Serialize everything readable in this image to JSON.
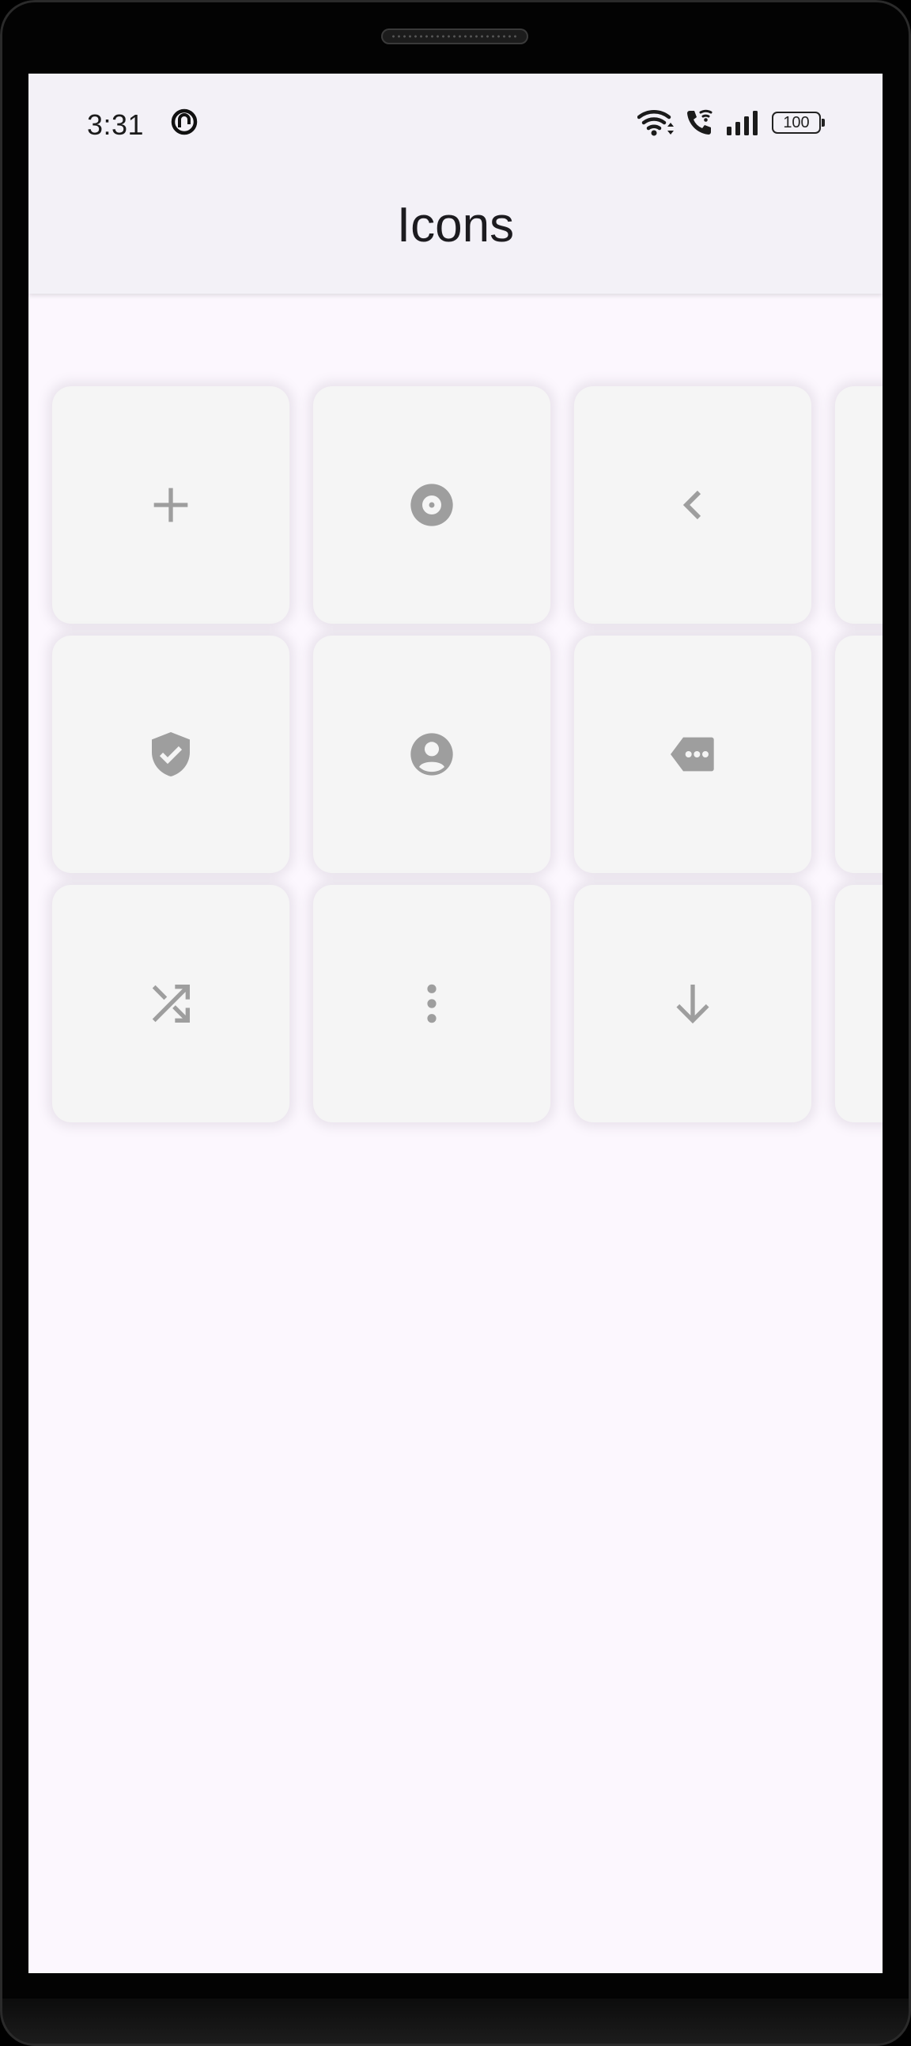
{
  "status_bar": {
    "time": "3:31",
    "app_icon": "notification-app-icon",
    "wifi_icon": "wifi-icon",
    "call_icon": "wifi-call-icon",
    "signal_icon": "signal-icon",
    "battery_level": "100"
  },
  "app_bar": {
    "title": "Icons"
  },
  "colors": {
    "app_bar_bg": "#f3f1f7",
    "screen_bg": "#fcf7fe",
    "tile_bg": "#f5f5f5",
    "icon_color": "#9e9e9e"
  },
  "icon_grid": {
    "rows": [
      [
        "add-icon",
        "disc-icon",
        "chevron-left-icon",
        "partial-tile"
      ],
      [
        "verified-shield-icon",
        "account-circle-icon",
        "label-more-icon",
        "partial-tile"
      ],
      [
        "shuffle-icon",
        "more-vertical-icon",
        "arrow-down-icon",
        "partial-tile"
      ]
    ]
  }
}
